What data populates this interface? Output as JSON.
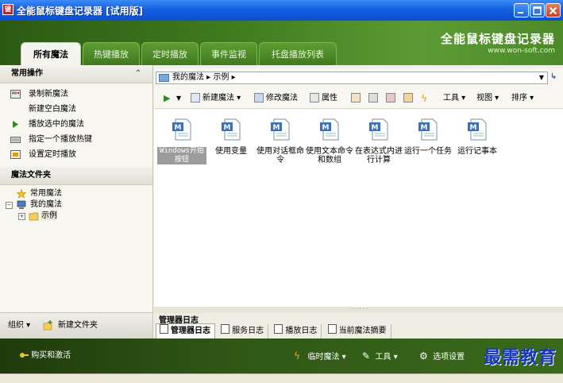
{
  "window": {
    "title": "全能鼠标键盘记录器 [试用版]"
  },
  "brand": {
    "name": "全能鼠标键盘记录器",
    "url": "www.won-soft.com"
  },
  "tabs": [
    {
      "label": "所有魔法",
      "active": true
    },
    {
      "label": "热键播放"
    },
    {
      "label": "定时播放"
    },
    {
      "label": "事件监视"
    },
    {
      "label": "托盘播放列表"
    }
  ],
  "sidebar": {
    "ops_title": "常用操作",
    "ops": [
      {
        "label": "录制新魔法",
        "icon": "record-icon"
      },
      {
        "label": "新建空白魔法",
        "icon": "none"
      },
      {
        "label": "播放选中的魔法",
        "icon": "play-icon"
      },
      {
        "label": "指定一个播放热键",
        "icon": "keyboard-icon"
      },
      {
        "label": "设置定时播放",
        "icon": "timer-icon"
      }
    ],
    "folders_title": "魔法文件夹",
    "tree": [
      {
        "label": "常用魔法",
        "icon": "star-icon"
      },
      {
        "label": "我的魔法",
        "icon": "computer-icon"
      },
      {
        "label": "示例",
        "icon": "folder-icon"
      }
    ],
    "footer": {
      "organize": "组织",
      "new_folder": "新建文件夹"
    }
  },
  "address": {
    "path": [
      "我的魔法",
      "示例"
    ]
  },
  "toolbar": {
    "new": "新建魔法",
    "edit": "修改魔法",
    "props": "属性",
    "tools": "工具",
    "view": "视图",
    "sort": "排序"
  },
  "files": [
    {
      "label": "Windows开始按钮",
      "selected": true
    },
    {
      "label": "使用变量"
    },
    {
      "label": "使用对话框命令"
    },
    {
      "label": "使用文本命令和数组"
    },
    {
      "label": "在表达式内进行计算"
    },
    {
      "label": "运行一个任务"
    },
    {
      "label": "运行记事本"
    }
  ],
  "log": {
    "title": "管理器日志",
    "tabs": [
      "管理器日志",
      "服务日志",
      "播放日志",
      "当前魔法摘要"
    ]
  },
  "bottom": {
    "buy": "购买和激活",
    "temp_magic": "临时魔法",
    "tools": "工具",
    "options": "选项设置"
  },
  "watermark": "最需教育",
  "colors": {
    "header_green": "#3f7a1e",
    "title_blue": "#1560e0"
  }
}
